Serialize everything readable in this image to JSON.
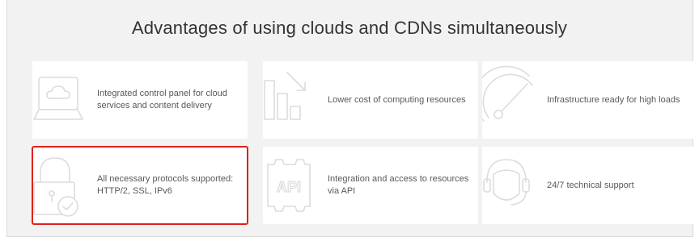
{
  "title": "Advantages of using clouds and CDNs simultaneously",
  "cards": [
    {
      "label": "Integrated control panel for cloud services and content delivery",
      "icon": "cloud-panel-icon"
    },
    {
      "label": "Lower cost of computing resources",
      "icon": "cost-chart-icon"
    },
    {
      "label": "Infrastructure ready for high loads",
      "icon": "speedometer-icon"
    },
    {
      "label": "All necessary protocols supported: HTTP/2, SSL, IPv6",
      "icon": "lock-check-icon",
      "selected": true
    },
    {
      "label": "Integration and access to resources via API",
      "icon": "api-gear-icon"
    },
    {
      "label": "24/7 technical support",
      "icon": "headset-icon"
    }
  ],
  "colors": {
    "background": "#f2f2f2",
    "card": "#ffffff",
    "selection": "#e0201b"
  }
}
